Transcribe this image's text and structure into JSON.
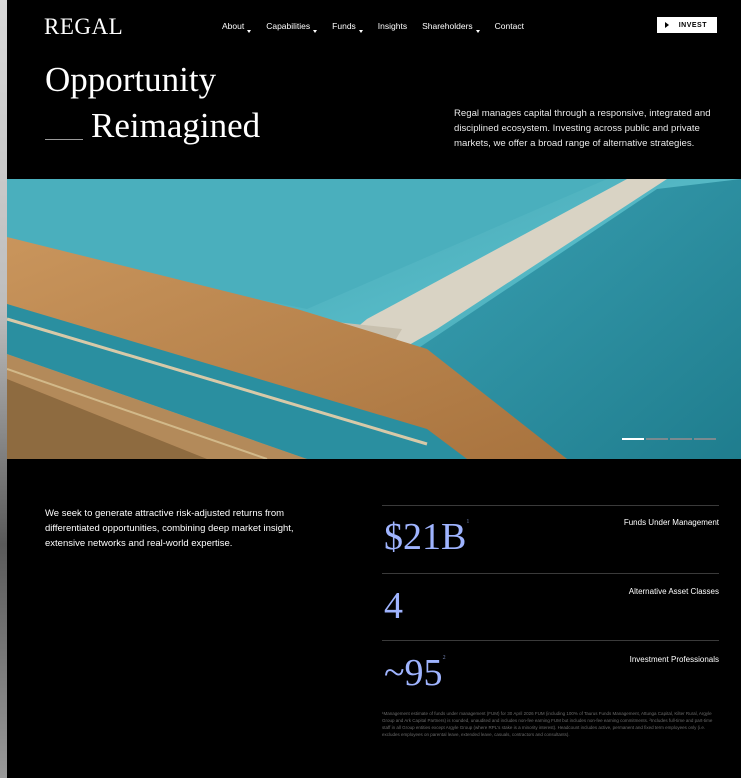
{
  "header": {
    "logo": "REGAL",
    "nav": [
      {
        "label": "About",
        "has_dropdown": true
      },
      {
        "label": "Capabilities",
        "has_dropdown": true
      },
      {
        "label": "Funds",
        "has_dropdown": true
      },
      {
        "label": "Insights",
        "has_dropdown": false
      },
      {
        "label": "Shareholders",
        "has_dropdown": true
      },
      {
        "label": "Contact",
        "has_dropdown": false
      }
    ],
    "invest_label": "INVEST"
  },
  "hero": {
    "title_line1": "Opportunity",
    "title_line2": "Reimagined",
    "description": "Regal manages capital through a responsive, integrated and disciplined ecosystem. Investing across public and private markets, we offer a broad range of alternative strategies."
  },
  "carousel": {
    "slides": 4,
    "active": 0
  },
  "mission": "We seek to generate attractive risk-adjusted returns from differentiated opportunities, combining deep market insight, extensive networks and real-world expertise.",
  "stats": [
    {
      "value": "$21B",
      "note": "1",
      "label": "Funds Under Management"
    },
    {
      "value": "4",
      "note": "",
      "label": "Alternative Asset Classes"
    },
    {
      "value": "~95",
      "note": "2",
      "label": "Investment Professionals"
    }
  ],
  "footnote": "¹Management estimate of funds under management (FUM) for 30 April 2026 FUM (including 100% of Taurus Funds Management, Attunga Capital, Kilter Rural, Argyle Group and Ark Capital Partners) is rounded, unaudited and includes non-fee earning FUM but includes non-fee earning commitments. ²Includes full-time and part-time staff in all Group entities except Argyle Group (where RPL's stake is a minority interest). Headcount includes active, permanent and fixed term employees only (i.e. excludes employees on parental leave, extended leave, casuals, contractors and consultants).",
  "colors": {
    "accent": "#9fb4ff",
    "background": "#000000"
  }
}
